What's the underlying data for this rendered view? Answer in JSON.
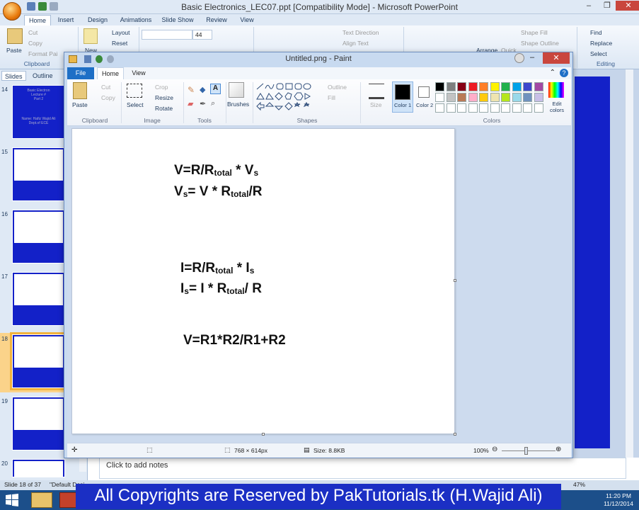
{
  "ppt": {
    "title": "Basic Electronics_LEC07.ppt [Compatibility Mode] - Microsoft PowerPoint",
    "tabs": [
      "Home",
      "Insert",
      "Design",
      "Animations",
      "Slide Show",
      "Review",
      "View"
    ],
    "ribbon": {
      "paste": "Paste",
      "cut": "Cut",
      "copy": "Copy",
      "format_painter": "Format Pai",
      "clipboard": "Clipboard",
      "new": "New",
      "layout": "Layout",
      "reset": "Reset",
      "font_size": "44",
      "text_direction": "Text Direction",
      "align_text": "Align Text",
      "arrange": "Arrange",
      "quick": "Quick",
      "shape_fill": "Shape Fill",
      "shape_outline": "Shape Outline",
      "find": "Find",
      "replace": "Replace",
      "select": "Select",
      "editing": "Editing"
    },
    "panel_tabs": [
      "Slides",
      "Outline"
    ],
    "slide_numbers": [
      "14",
      "15",
      "16",
      "17",
      "18",
      "19",
      "20"
    ],
    "thumb14_text": [
      "Basic Electron",
      "Lecture #",
      "Part 2",
      "Name: Hafiz Wajid Ali",
      "Dept.of ECE"
    ],
    "notes_placeholder": "Click to add notes",
    "status_slide": "Slide 18 of 37",
    "status_theme": "\"Default Desi",
    "zoom_partial": "47%"
  },
  "paint": {
    "title": "Untitled.png - Paint",
    "tabs": [
      "File",
      "Home",
      "View"
    ],
    "ribbon": {
      "paste": "Paste",
      "cut": "Cut",
      "copy": "Copy",
      "clipboard": "Clipboard",
      "select": "Select",
      "crop": "Crop",
      "resize": "Resize",
      "rotate": "Rotate",
      "image": "Image",
      "tools": "Tools",
      "brushes": "Brushes",
      "outline": "Outline",
      "fill": "Fill",
      "shapes": "Shapes",
      "size": "Size",
      "color1": "Color 1",
      "color2": "Color 2",
      "colors": "Colors",
      "edit_colors": "Edit colors"
    },
    "palette": [
      "#000000",
      "#7f7f7f",
      "#880015",
      "#ed1c24",
      "#ff7f27",
      "#fff200",
      "#22b14c",
      "#00a2e8",
      "#3f48cc",
      "#a349a4",
      "#ffffff",
      "#c3c3c3",
      "#b97a57",
      "#ffaec9",
      "#ffc90e",
      "#efe4b0",
      "#b5e61d",
      "#99d9ea",
      "#7092be",
      "#c8bfe7"
    ],
    "formulas": {
      "f1": {
        "a": "V=R/R",
        "sub1": "total",
        "b": " * V",
        "sub2": "s"
      },
      "f2": {
        "a": "V",
        "sub1": "s",
        "b": "= V * R",
        "sub2": "total",
        "c": "/R"
      },
      "f3": {
        "a": "I=R/R",
        "sub1": "total",
        "b": " * I",
        "sub2": "s"
      },
      "f4": {
        "a": "I",
        "sub1": "s",
        "b": "= I * R",
        "sub2": "total",
        "c": "/ R"
      },
      "f5": "V=R1*R2/R1+R2"
    },
    "status": {
      "dims": "768 × 614px",
      "size": "Size: 8.8KB",
      "zoom": "100%"
    }
  },
  "banner": "All Copyrights are Reserved by PakTutorials.tk (H.Wajid Ali)",
  "clock": {
    "time": "11:20 PM",
    "date": "11/12/2014"
  }
}
